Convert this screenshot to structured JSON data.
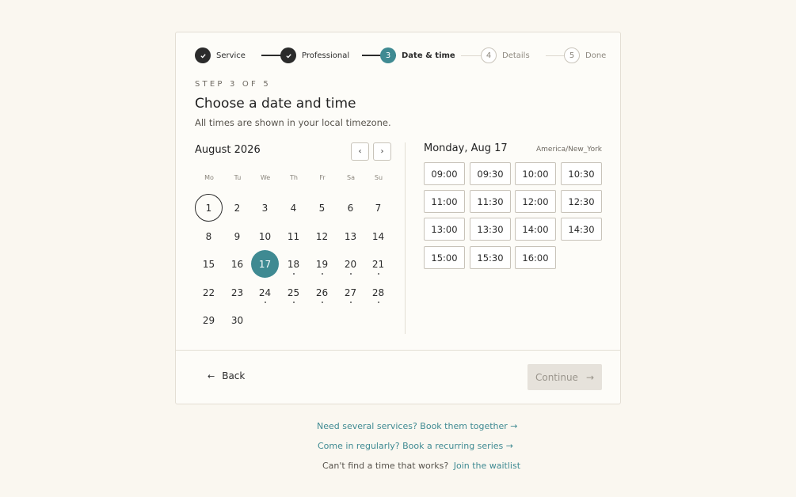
{
  "stepper": {
    "steps": [
      {
        "num": "",
        "icon": "check-icon",
        "label": "Service",
        "state": "done"
      },
      {
        "num": "",
        "icon": "check-icon",
        "label": "Professional",
        "state": "done"
      },
      {
        "num": "3",
        "label": "Date & time",
        "state": "active"
      },
      {
        "num": "4",
        "label": "Details",
        "state": "todo"
      },
      {
        "num": "5",
        "label": "Done",
        "state": "todo"
      }
    ]
  },
  "header": {
    "kicker": "STEP 3 OF 5",
    "title": "Choose a date and time",
    "subtitle": "All times are shown in your local timezone."
  },
  "calendar": {
    "month": "August 2026",
    "prev_icon": "‹",
    "next_icon": "›",
    "weekdays": [
      "Mo",
      "Tu",
      "We",
      "Th",
      "Fr",
      "Sa",
      "Su"
    ],
    "weeks": [
      [
        "1",
        "2",
        "3",
        "4",
        "5",
        "6",
        "7"
      ],
      [
        "8",
        "9",
        "10",
        "11",
        "12",
        "13",
        "14"
      ],
      [
        "15",
        "16",
        "17",
        "18",
        "19",
        "20",
        "21"
      ],
      [
        "22",
        "23",
        "24",
        "25",
        "26",
        "27",
        "28"
      ],
      [
        "29",
        "30"
      ]
    ],
    "today": "1",
    "selected": "17",
    "dotted_days": [
      "18",
      "19",
      "20",
      "21",
      "24",
      "25",
      "26",
      "27",
      "28"
    ]
  },
  "times": {
    "heading": "Monday, Aug 17",
    "timezone": "America/New_York",
    "slots": [
      "09:00",
      "09:30",
      "10:00",
      "10:30",
      "11:00",
      "11:30",
      "12:00",
      "12:30",
      "13:00",
      "13:30",
      "14:00",
      "14:30",
      "15:00",
      "15:30",
      "16:00"
    ]
  },
  "footer": {
    "back_label": "Back",
    "back_icon": "←",
    "continue_label": "Continue",
    "continue_icon": "→"
  },
  "links": {
    "multi": "Need several services? Book them together →",
    "recurring": "Come in regularly? Book a recurring series →",
    "waitlist_prefix": "Can't find a time that works?",
    "waitlist_link": "Join the waitlist"
  },
  "colors": {
    "accent": "#3f8a92",
    "background": "#faf7f0",
    "card": "#fdfcf8"
  }
}
